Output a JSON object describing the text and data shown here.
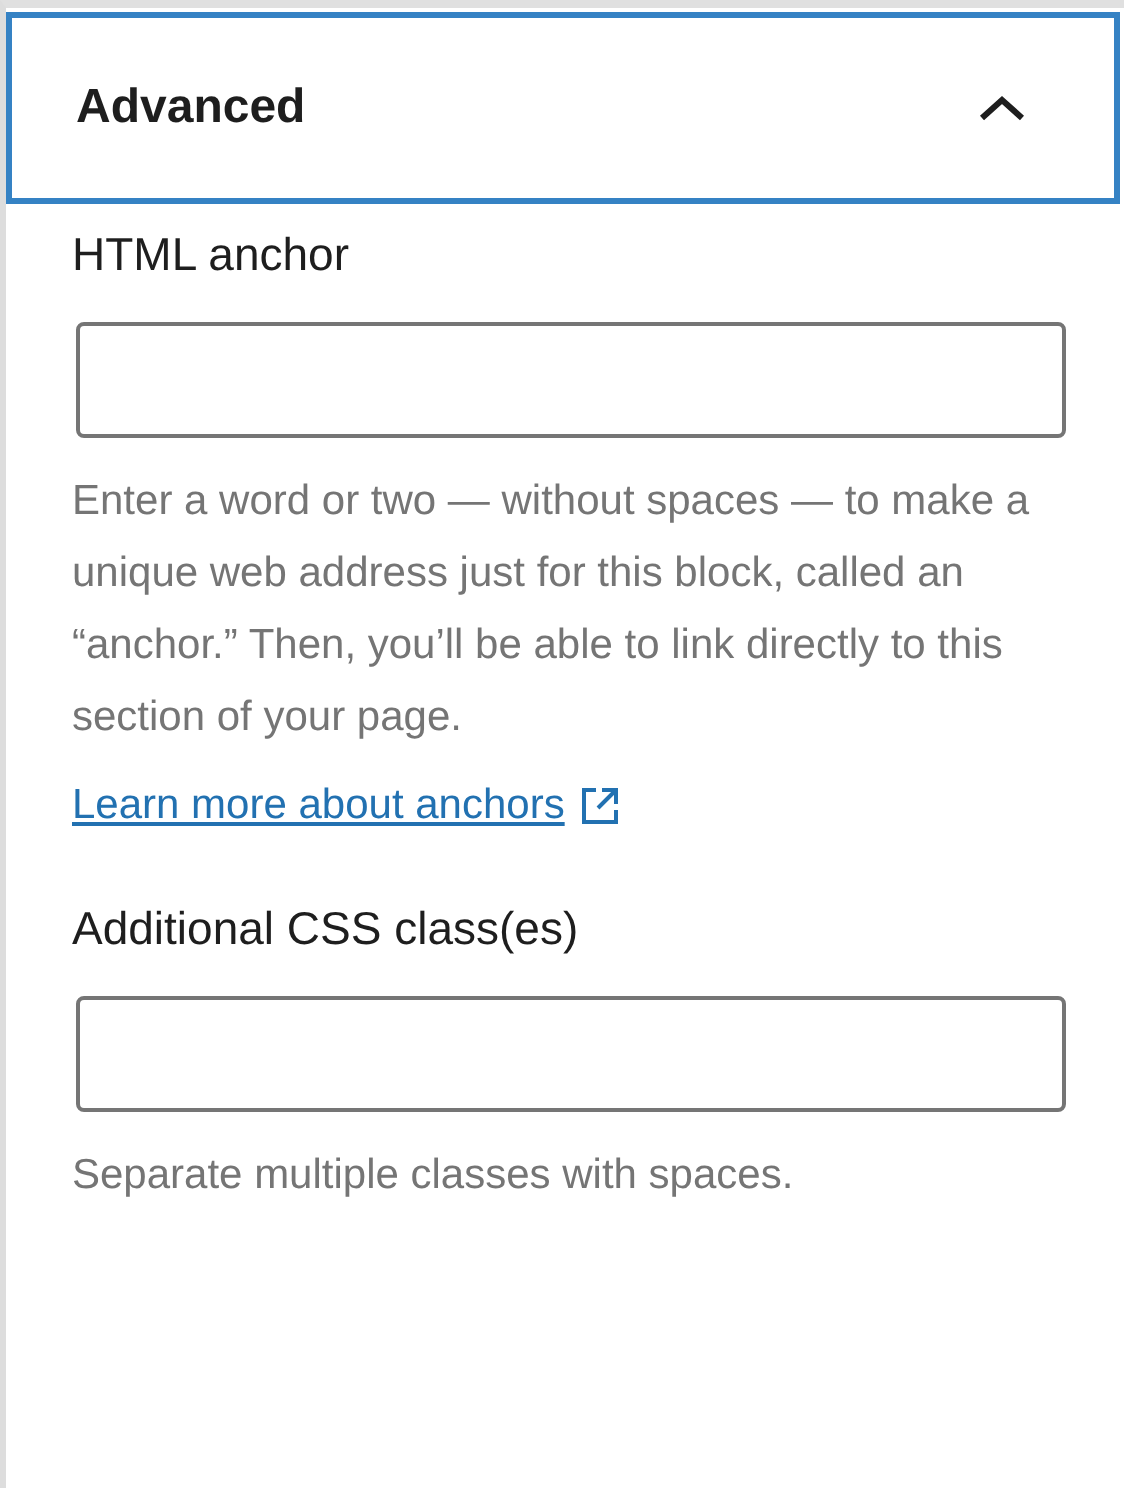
{
  "panel": {
    "title": "Advanced",
    "expanded": true,
    "focused": true
  },
  "fields": [
    {
      "label": "HTML anchor",
      "help": "Enter a word or two — without spaces — to make a unique web address just for this block, called an “anchor.” Then, you’ll be able to link directly to this section of your page.",
      "link": "Learn more about anchors"
    },
    {
      "label": "Additional CSS class(es)",
      "help": "Separate multiple classes with spaces."
    }
  ]
}
